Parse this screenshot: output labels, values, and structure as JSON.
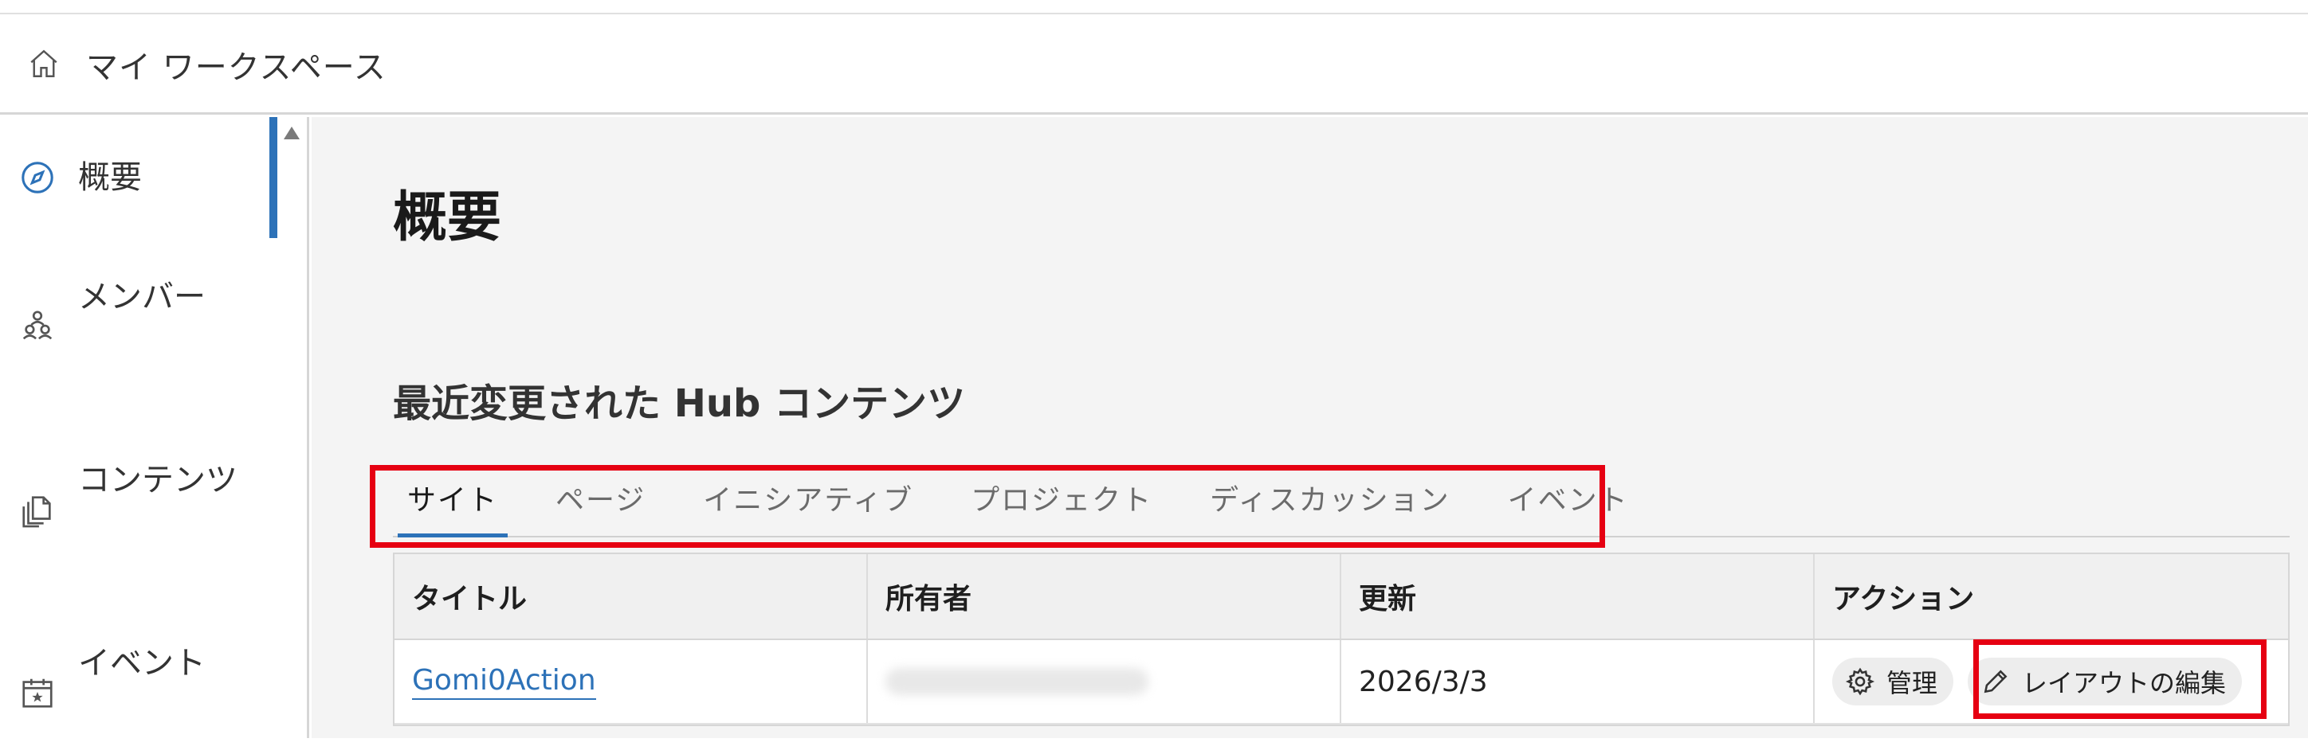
{
  "header": {
    "title": "マイ ワークスペース",
    "icon": "home-icon"
  },
  "sidebar": {
    "items": [
      {
        "label": "概要",
        "icon": "compass-icon",
        "active": true
      },
      {
        "label": "メンバー",
        "icon": "members-icon",
        "active": false
      },
      {
        "label": "コンテンツ",
        "icon": "content-copy-icon",
        "active": false
      },
      {
        "label": "イベント",
        "icon": "calendar-star-icon",
        "active": false
      }
    ]
  },
  "main": {
    "page_title": "概要",
    "section_title": "最近変更された Hub コンテンツ",
    "tabs": [
      {
        "label": "サイト",
        "active": true
      },
      {
        "label": "ページ",
        "active": false
      },
      {
        "label": "イニシアティブ",
        "active": false
      },
      {
        "label": "プロジェクト",
        "active": false
      },
      {
        "label": "ディスカッション",
        "active": false
      },
      {
        "label": "イベント",
        "active": false
      }
    ],
    "table": {
      "columns": [
        "タイトル",
        "所有者",
        "更新",
        "アクション"
      ],
      "rows": [
        {
          "title": "Gomi0Action",
          "updated": "2026/3/3",
          "manage_label": "管理",
          "edit_layout_label": "レイアウトの編集"
        }
      ]
    }
  },
  "colors": {
    "accent": "#2d72b8",
    "highlight_border": "#e60012"
  }
}
